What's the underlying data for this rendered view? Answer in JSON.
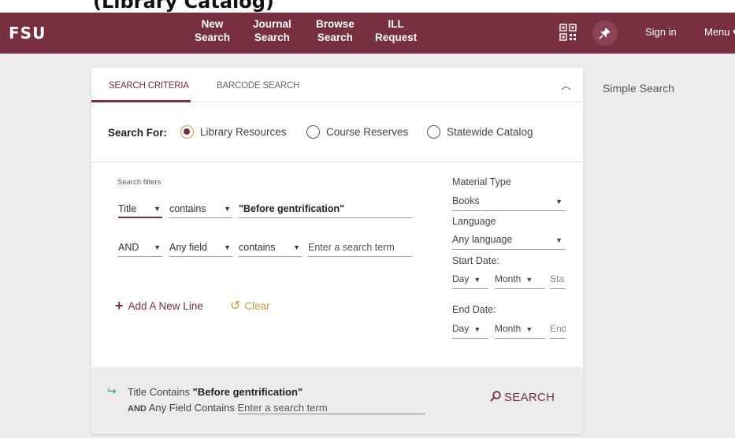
{
  "page": {
    "cut_heading": "(Library Catalog)"
  },
  "navbar": {
    "logo": "FSU",
    "items": [
      {
        "line1": "New",
        "line2": "Search"
      },
      {
        "line1": "Journal",
        "line2": "Search"
      },
      {
        "line1": "Browse",
        "line2": "Search"
      },
      {
        "line1": "ILL",
        "line2": "Request"
      }
    ],
    "signin": "Sign in",
    "menu": "Menu"
  },
  "tabs": {
    "active": "SEARCH CRITERIA",
    "other": "BARCODE SEARCH"
  },
  "search_for": {
    "label": "Search For:",
    "options": [
      "Library Resources",
      "Course Reserves",
      "Statewide Catalog"
    ],
    "selected": "Library Resources"
  },
  "filters": {
    "title": "Search filters",
    "row1": {
      "field": "Title",
      "op": "contains",
      "term": "\"Before gentrification\""
    },
    "row2": {
      "bool": "AND",
      "field": "Any field",
      "op": "contains",
      "placeholder": "Enter a search term"
    }
  },
  "side": {
    "material_label": "Material Type",
    "material_value": "Books",
    "language_label": "Language",
    "language_value": "Any language",
    "start_label": "Start Date:",
    "start": {
      "day": "Day",
      "month": "Month",
      "year": "Sta"
    },
    "end_label": "End Date:",
    "end": {
      "day": "Day",
      "month": "Month",
      "year": "End"
    }
  },
  "actions": {
    "add_line": "Add A New Line",
    "clear": "Clear"
  },
  "summary": {
    "line1_field": "Title",
    "line1_op": "Contains",
    "line1_term": "\"Before gentrification\"",
    "line2_bool": "AND",
    "line2_field": "Any Field",
    "line2_op": "Contains",
    "line2_placeholder": "Enter a search term",
    "search_label": "SEARCH"
  },
  "simple_search": "Simple Search",
  "colors": {
    "brand": "#782f40",
    "accent": "#c89a3c",
    "arrow": "#3a9b5e"
  }
}
